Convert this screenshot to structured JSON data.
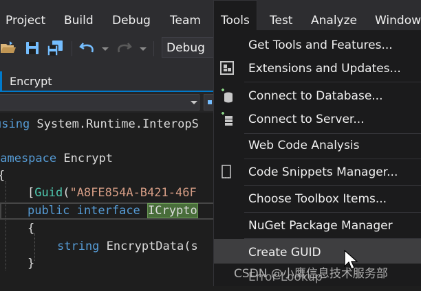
{
  "menubar": {
    "items": [
      "Project",
      "Build",
      "Debug",
      "Team",
      "Tools",
      "Test",
      "Analyze",
      "Window"
    ],
    "active": "Tools"
  },
  "toolbar": {
    "configuration": "Debug",
    "icons": [
      "open-folder-icon",
      "save-icon",
      "save-all-icon",
      "undo-icon",
      "redo-icon"
    ]
  },
  "document": {
    "tab_label": "Encrypt"
  },
  "code": {
    "line1_using": "using",
    "line1_rest": " System.Runtime.InteropS",
    "line3_namespace": "namespace",
    "line3_name": " Encrypt",
    "line4_brace": "{",
    "line5_open": "[",
    "line5_attr": "Guid",
    "line5_paren": "(",
    "line5_string": "\"A8FE854A-B421-46F",
    "line6_public": "public",
    "line6_interface": "interface",
    "line6_name": "ICrypto",
    "line7_brace": "{",
    "line8_string_kw": "string",
    "line8_method": " EncryptData(s",
    "line9_brace": "}"
  },
  "tools_menu": {
    "items": [
      {
        "label": "Get Tools and Features...",
        "icon": ""
      },
      {
        "label": "Extensions and Updates...",
        "icon": "extensions-icon"
      },
      {
        "label": "Connect to Database...",
        "icon": "database-icon"
      },
      {
        "label": "Connect to Server...",
        "icon": "server-icon"
      },
      {
        "label": "Web Code Analysis",
        "icon": ""
      },
      {
        "label": "Code Snippets Manager...",
        "icon": "snippet-icon"
      },
      {
        "label": "Choose Toolbox Items...",
        "icon": ""
      },
      {
        "label": "NuGet Package Manager",
        "icon": ""
      },
      {
        "label": "Create GUID",
        "icon": ""
      },
      {
        "label": "Error Lookup",
        "icon": ""
      }
    ],
    "highlighted": "Create GUID"
  },
  "watermark": "CSDN @小鹰信息技术服务部",
  "colors": {
    "accent": "#007acc",
    "menu_bg": "#1b1b1c",
    "hover_bg": "#3e3e40",
    "keyword": "#569cd6",
    "type": "#4ec9b0",
    "string": "#d69d85"
  }
}
